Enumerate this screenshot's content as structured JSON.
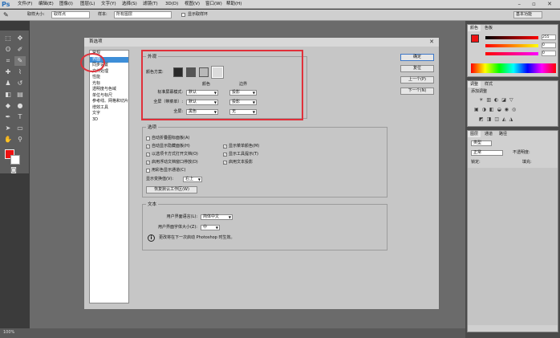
{
  "app": {
    "logo": "Ps"
  },
  "menubar": {
    "items": [
      "文件(F)",
      "编辑(E)",
      "图像(I)",
      "图层(L)",
      "文字(Y)",
      "选择(S)",
      "滤镜(T)",
      "3D(D)",
      "视图(V)",
      "窗口(W)",
      "帮助(H)"
    ],
    "window_controls": "– ▫ ✕"
  },
  "options": {
    "sample_size_label": "取样大小:",
    "sample_size_value": "取样点",
    "sample_label": "样本:",
    "sample_value": "所有图层",
    "show_ring_label": "显示取样环",
    "workspace": "基本功能"
  },
  "dialog": {
    "title": "首选项",
    "close_glyph": "✕",
    "categories": [
      "常规",
      "界面",
      "同步设置",
      "文件处理",
      "性能",
      "光标",
      "透明度与色域",
      "单位与标尺",
      "参考线、网格和切片",
      "增效工具",
      "文字",
      "3D"
    ],
    "selected_index": 1,
    "appearance": {
      "legend": "外观",
      "color_scheme_label": "颜色方案:",
      "swatch_colors": [
        "#2a2a2a",
        "#555555",
        "#b8b8b8",
        "#dcdcdc"
      ],
      "col_color": "颜色",
      "col_border": "边界",
      "rows": [
        {
          "label": "标准屏幕模式:",
          "color": "默认",
          "border": "投影"
        },
        {
          "label": "全屏（带菜单）:",
          "color": "默认",
          "border": "投影"
        },
        {
          "label": "全屏:",
          "color": "黑色",
          "border": "无"
        }
      ]
    },
    "options": {
      "legend": "选项",
      "left_checks": [
        {
          "label": "自动折叠图标面板(A)",
          "checked": false
        },
        {
          "label": "自动显示隐藏面板(H)",
          "checked": true
        },
        {
          "label": "以选项卡方式打开文档(O)",
          "checked": true
        },
        {
          "label": "启用浮动文档窗口停放(D)",
          "checked": true
        },
        {
          "label": "用彩色显示通道(C)",
          "checked": false
        }
      ],
      "right_checks": [
        {
          "label": "显示菜单颜色(M)",
          "checked": true
        },
        {
          "label": "显示工具提示(T)",
          "checked": true
        },
        {
          "label": "启用文本投影",
          "checked": true
        }
      ],
      "transform_label": "显示变换值(V):",
      "transform_value": "右上",
      "reset_button": "恢复默认工作区(W)"
    },
    "text": {
      "legend": "文本",
      "ui_lang_label": "用户界面语言(L):",
      "ui_lang_value": "简体中文",
      "ui_font_label": "用户界面字体大小(Z):",
      "ui_font_value": "中",
      "note": "更改将在下一次启动 Photoshop 时生效。"
    },
    "buttons": {
      "ok": "确定",
      "reset": "复位",
      "prev": "上一个(P)",
      "next": "下一个(N)"
    }
  },
  "panels": {
    "color_tabs": [
      "颜色",
      "色板"
    ],
    "adjust_tabs": [
      "调整",
      "样式"
    ],
    "adjust_add": "添加调整",
    "layers_tabs": [
      "图层",
      "通道",
      "路径"
    ],
    "layers_kind": "类型",
    "layers_mode": "正常",
    "layers_opacity": "不透明度:",
    "layers_lock": "锁定:",
    "layers_fill": "填充:",
    "color_values": [
      "255",
      "0",
      "0"
    ]
  },
  "status": {
    "zoom": "100%"
  }
}
